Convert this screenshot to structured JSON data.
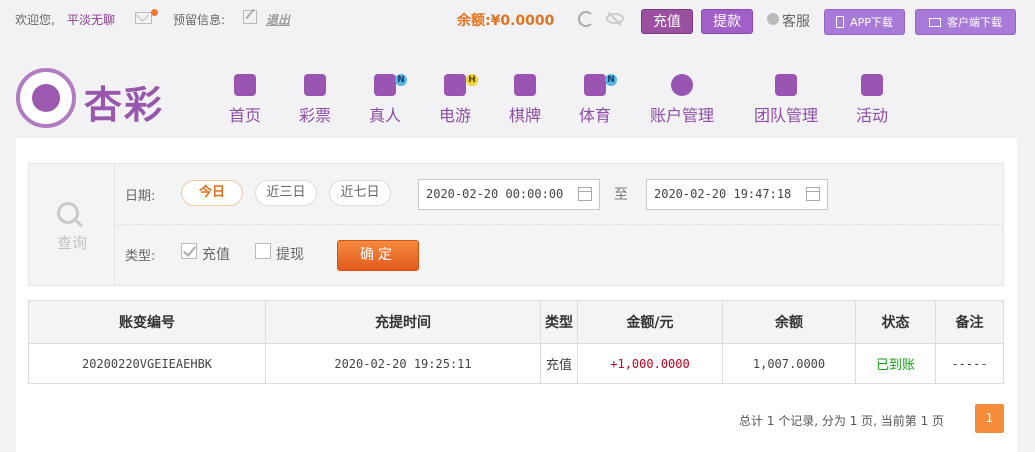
{
  "topbar": {
    "welcome": "欢迎您,",
    "username": "平淡无聊",
    "reserved_info": "预留信息:",
    "logout": "退出",
    "balance_label": "余额:",
    "balance_value": "¥0.0000",
    "recharge": "充值",
    "withdraw": "提款",
    "customer_service": "客服",
    "app_download": "APP下载",
    "client_download": "客户端下载"
  },
  "logo": {
    "text": "杏彩"
  },
  "nav": {
    "items": [
      {
        "label": "首页",
        "icon": "home-icon",
        "badge": ""
      },
      {
        "label": "彩票",
        "icon": "lottery-ticket-icon",
        "badge": ""
      },
      {
        "label": "真人",
        "icon": "live-dealer-icon",
        "badge": "N"
      },
      {
        "label": "电游",
        "icon": "gamepad-icon",
        "badge": "H"
      },
      {
        "label": "棋牌",
        "icon": "cards-icon",
        "badge": ""
      },
      {
        "label": "体育",
        "icon": "trophy-icon",
        "badge": "N"
      },
      {
        "label": "账户管理",
        "icon": "yen-coin-icon",
        "badge": ""
      },
      {
        "label": "团队管理",
        "icon": "team-icon",
        "badge": ""
      },
      {
        "label": "活动",
        "icon": "gift-icon",
        "badge": ""
      }
    ]
  },
  "filter": {
    "query_label": "查询",
    "date_label": "日期:",
    "today": "今日",
    "last3": "近三日",
    "last7": "近七日",
    "start_date": "2020-02-20 00:00:00",
    "to": "至",
    "end_date": "2020-02-20 19:47:18",
    "type_label": "类型:",
    "type_recharge": "充值",
    "type_withdraw": "提现",
    "recharge_checked": true,
    "withdraw_checked": false,
    "confirm": "确定"
  },
  "table": {
    "headers": [
      "账变编号",
      "充提时间",
      "类型",
      "金额/元",
      "余额",
      "状态",
      "备注"
    ],
    "rows": [
      [
        "20200220VGEIEAEHBK",
        "2020-02-20 19:25:11",
        "充值",
        "+1,000.0000",
        "1,007.0000",
        "已到账",
        "-----"
      ]
    ]
  },
  "pager": {
    "summary": "总计 1 个记录, 分为 1 页, 当前第 1 页",
    "current_page": "1"
  },
  "colors": {
    "brand_purple": "#9856ad",
    "accent_orange": "#e45c1e",
    "amount_red": "#c00020",
    "status_green": "#1a9a1a"
  }
}
